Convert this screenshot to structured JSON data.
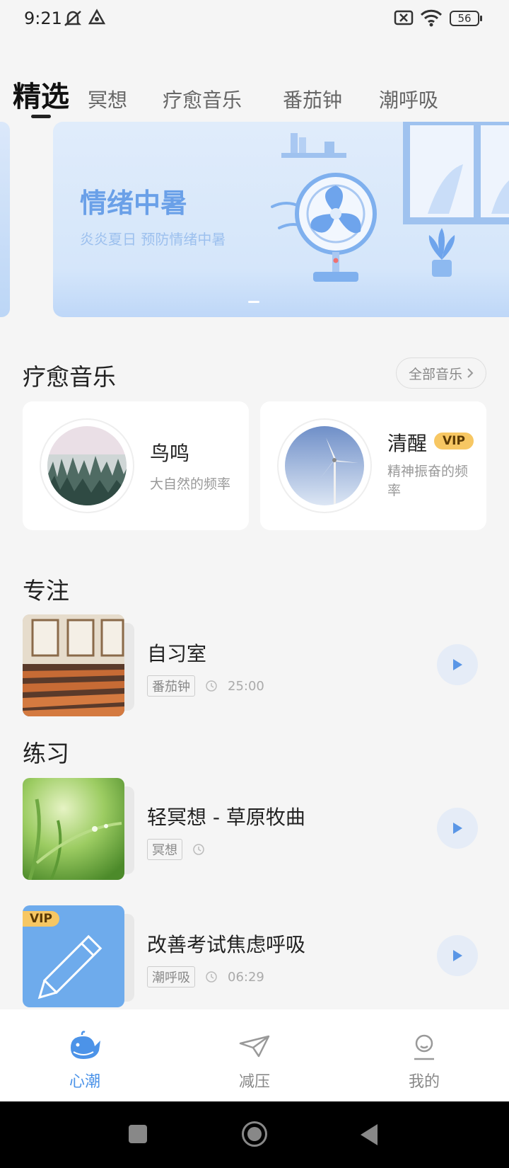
{
  "status_bar": {
    "time": "9:21",
    "battery": "56"
  },
  "tabs": [
    {
      "label": "精选",
      "active": true
    },
    {
      "label": "冥想"
    },
    {
      "label": "疗愈音乐"
    },
    {
      "label": "番茄钟"
    },
    {
      "label": "潮呼吸"
    }
  ],
  "banner": {
    "title": "情绪中暑",
    "subtitle": "炎炎夏日 预防情绪中暑"
  },
  "music_section": {
    "title": "疗愈音乐",
    "more_label": "全部音乐",
    "cards": [
      {
        "title": "鸟鸣",
        "subtitle": "大自然的频率"
      },
      {
        "title": "清醒",
        "subtitle": "精神振奋的频率",
        "badge": "VIP"
      }
    ]
  },
  "focus_section": {
    "title": "专注",
    "items": [
      {
        "title": "自习室",
        "tag": "番茄钟",
        "duration": "25:00"
      }
    ]
  },
  "practice_section": {
    "title": "练习",
    "items": [
      {
        "title": "轻冥想 - 草原牧曲",
        "tag": "冥想",
        "duration": ""
      },
      {
        "title": "改善考试焦虑呼吸",
        "tag": "潮呼吸",
        "duration": "06:29",
        "badge": "VIP"
      }
    ]
  },
  "bottom_nav": [
    {
      "label": "心潮",
      "icon": "whale-icon",
      "active": true
    },
    {
      "label": "减压",
      "icon": "paper-plane-icon"
    },
    {
      "label": "我的",
      "icon": "profile-icon"
    }
  ],
  "colors": {
    "accent": "#4c93e8",
    "vip": "#f7c763",
    "banner_text": "#6aa0e8"
  }
}
